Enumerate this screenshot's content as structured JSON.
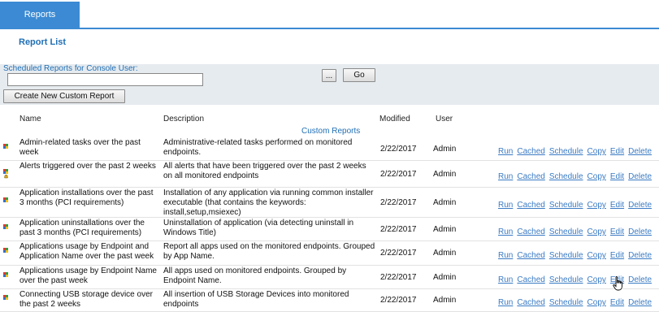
{
  "tabs": [
    {
      "label": "Reports",
      "active": true
    }
  ],
  "page_title": "Report List",
  "scheduled": {
    "label": "Scheduled Reports for Console User:",
    "input_value": "",
    "browse_label": "...",
    "go_label": "Go",
    "create_label": "Create New Custom Report"
  },
  "columns": {
    "name": "Name",
    "description": "Description",
    "modified": "Modified",
    "user": "User"
  },
  "group_label": "Custom Reports",
  "actions": [
    "Run",
    "Cached",
    "Schedule",
    "Copy",
    "Edit",
    "Delete"
  ],
  "rows": [
    {
      "name": "Admin-related tasks over the past week",
      "description": "Administrative-related tasks performed on monitored endpoints.",
      "modified": "2/22/2017",
      "user": "Admin"
    },
    {
      "name": "Alerts triggered over the past 2 weeks",
      "description": "All alerts that have been triggered over the past 2 weeks on all monitored endpoints",
      "modified": "2/22/2017",
      "user": "Admin"
    },
    {
      "name": "Application installations over the past 3 months (PCI requirements)",
      "description": "Installation of any application via running common installer executable (that contains the keywords: install,setup,msiexec)",
      "modified": "2/22/2017",
      "user": "Admin"
    },
    {
      "name": "Application uninstallations over the past 3 months (PCI requirements)",
      "description": "Uninstallation of application (via detecting uninstall in Windows Title)",
      "modified": "2/22/2017",
      "user": "Admin"
    },
    {
      "name": "Applications usage by Endpoint and Application Name over the past week",
      "description": "Report all apps used on the monitored endpoints. Grouped by App Name.",
      "modified": "2/22/2017",
      "user": "Admin"
    },
    {
      "name": "Applications usage by Endpoint Name over the past week",
      "description": "All apps used on monitored endpoints. Grouped by Endpoint Name.",
      "modified": "2/22/2017",
      "user": "Admin"
    },
    {
      "name": "Connecting USB storage device over the past 2 weeks",
      "description": "All insertion of USB Storage Devices into monitored endpoints",
      "modified": "2/22/2017",
      "user": "Admin"
    }
  ]
}
